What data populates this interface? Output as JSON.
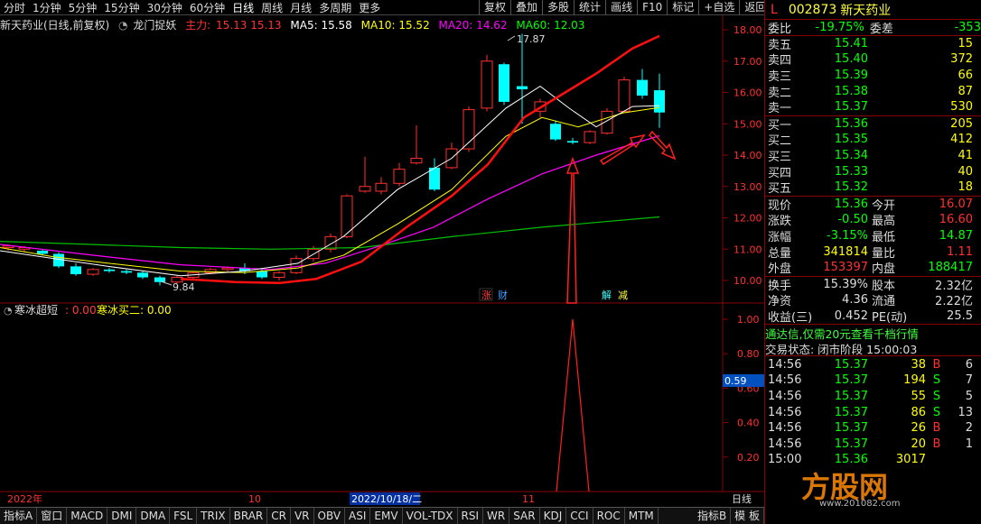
{
  "toolbar": {
    "periods": [
      "分时",
      "1分钟",
      "5分钟",
      "15分钟",
      "30分钟",
      "60分钟",
      "日线",
      "周线",
      "月线",
      "多周期",
      "更多"
    ],
    "active": "日线",
    "buttons": [
      "复权",
      "叠加",
      "多股",
      "统计",
      "画线",
      "F10",
      "标记",
      "+自选",
      "返回"
    ]
  },
  "chart_info": {
    "name": "新天药业(日线,前复权)",
    "indicator": "龙门捉妖",
    "zhuli_label": "主力:",
    "zhuli_vals": "15.13  15.13",
    "ma5": "MA5: 15.58",
    "ma10": "MA10: 15.52",
    "ma20": "MA20: 14.62",
    "ma60": "MA60: 12.03",
    "high_label": "17.87",
    "low_label": "9.84",
    "tag_zhang": "涨",
    "tag_cai": "财",
    "tag_jie": "解",
    "tag_jian": "减",
    "colors": {
      "ma5": "#ffffff",
      "ma10": "#ffff00",
      "ma20": "#ff00ff",
      "ma60": "#00ff00",
      "zhuli": "#ff0000",
      "up": "#ff3030",
      "down": "#00ffff"
    }
  },
  "price_axis": [
    "18.00",
    "17.00",
    "16.00",
    "15.00",
    "14.00",
    "13.00",
    "12.00",
    "11.00",
    "10.00"
  ],
  "indicator_panel": {
    "name": "寒冰超短",
    "value": ": 0.00",
    "sub_name": "寒冰买二",
    "sub_value": ": 0.00",
    "axis": [
      "1.00",
      "0.80",
      "0.60",
      "0.40",
      "0.20"
    ],
    "cursor_value": "0.59"
  },
  "date_axis": {
    "year": "2022年",
    "m10": "10",
    "cursor_date": "2022/10/18/二",
    "m11": "11",
    "period_label": "日线"
  },
  "bottom_bar": {
    "items": [
      "指标A",
      "窗口",
      "MACD",
      "DMI",
      "DMA",
      "FSL",
      "TRIX",
      "BRAR",
      "CR",
      "VR",
      "OBV",
      "ASI",
      "EMV",
      "VOL-TDX",
      "RSI",
      "WR",
      "SAR",
      "KDJ",
      "CCI",
      "ROC",
      "MTM"
    ],
    "right": [
      "指标B",
      "模 板"
    ]
  },
  "quote": {
    "mark": "L",
    "code": "002873",
    "name": "新天药业",
    "weibi_label": "委比",
    "weibi": "-19.75%",
    "weicha_label": "委差",
    "weicha": "-353",
    "sell": [
      {
        "label": "卖五",
        "price": "15.41",
        "vol": "15"
      },
      {
        "label": "卖四",
        "price": "15.40",
        "vol": "372"
      },
      {
        "label": "卖三",
        "price": "15.39",
        "vol": "66"
      },
      {
        "label": "卖二",
        "price": "15.38",
        "vol": "87"
      },
      {
        "label": "卖一",
        "price": "15.37",
        "vol": "530"
      }
    ],
    "buy": [
      {
        "label": "买一",
        "price": "15.36",
        "vol": "205"
      },
      {
        "label": "买二",
        "price": "15.35",
        "vol": "412"
      },
      {
        "label": "买三",
        "price": "15.34",
        "vol": "41"
      },
      {
        "label": "买四",
        "price": "15.33",
        "vol": "40"
      },
      {
        "label": "买五",
        "price": "15.32",
        "vol": "18"
      }
    ],
    "stats": [
      {
        "l1": "现价",
        "v1": "15.36",
        "l2": "今开",
        "v2": "16.07"
      },
      {
        "l1": "涨跌",
        "v1": "-0.50",
        "l2": "最高",
        "v2": "16.60"
      },
      {
        "l1": "涨幅",
        "v1": "-3.15%",
        "l2": "最低",
        "v2": "14.87"
      },
      {
        "l1": "总量",
        "v1": "341814",
        "l2": "量比",
        "v2": "1.11"
      },
      {
        "l1": "外盘",
        "v1": "153397",
        "l2": "内盘",
        "v2": "188417"
      }
    ],
    "stats2": [
      {
        "l1": "换手",
        "v1": "15.39%",
        "l2": "股本",
        "v2": "2.32亿"
      },
      {
        "l1": "净资",
        "v1": "4.36",
        "l2": "流通",
        "v2": "2.22亿"
      },
      {
        "l1": "收益(三)",
        "v1": "0.452",
        "l2": "PE(动)",
        "v2": "25.5"
      }
    ],
    "ad": "通达信,仅需20元查看千档行情",
    "trade_status": "交易状态: 闭市阶段 15:00:03",
    "ticks": [
      {
        "t": "14:56",
        "p": "15.37",
        "v": "38",
        "bs": "B",
        "n": "6"
      },
      {
        "t": "14:56",
        "p": "15.37",
        "v": "194",
        "bs": "S",
        "n": "7"
      },
      {
        "t": "14:56",
        "p": "15.37",
        "v": "55",
        "bs": "S",
        "n": "5"
      },
      {
        "t": "14:56",
        "p": "15.37",
        "v": "86",
        "bs": "S",
        "n": "13"
      },
      {
        "t": "14:56",
        "p": "15.37",
        "v": "26",
        "bs": "B",
        "n": "2"
      },
      {
        "t": "14:56",
        "p": "15.37",
        "v": "20",
        "bs": "B",
        "n": "1"
      },
      {
        "t": "15:00",
        "p": "15.36",
        "v": "3017",
        "bs": "",
        "n": ""
      }
    ]
  },
  "watermark": {
    "text": "方股网",
    "url": "www.201082.com"
  }
}
